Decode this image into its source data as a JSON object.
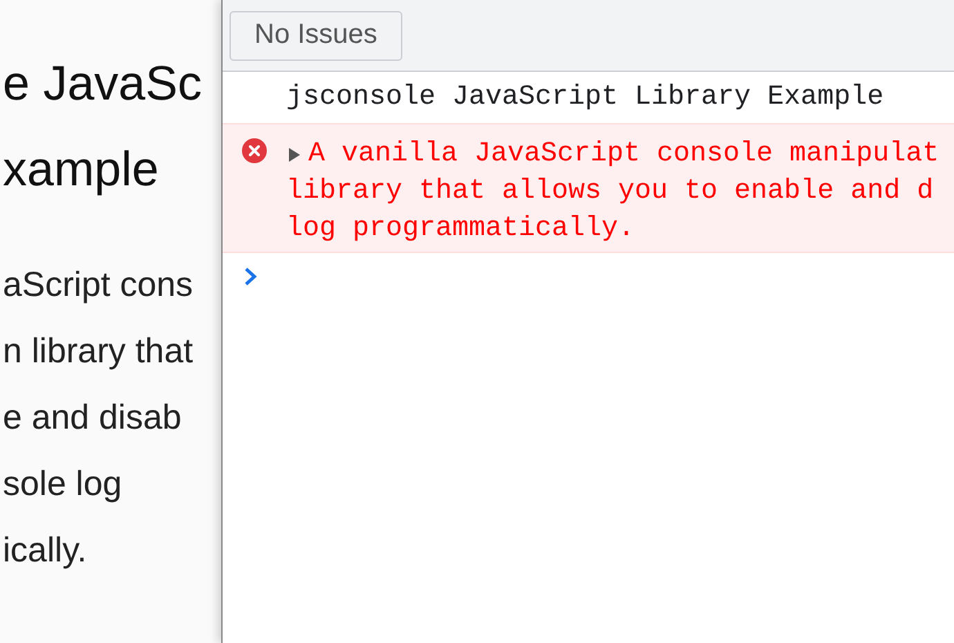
{
  "page": {
    "heading_lines": [
      "e JavaSc",
      "xample"
    ],
    "body_lines": [
      "aScript cons",
      "n library that",
      "e and disab",
      "sole log",
      "ically."
    ]
  },
  "devtools": {
    "issues_button": "No Issues",
    "messages": [
      {
        "kind": "log",
        "lines": [
          "jsconsole JavaScript Library Example"
        ]
      },
      {
        "kind": "error",
        "expanded": false,
        "lines": [
          "A vanilla JavaScript console manipulat",
          "library that allows you to enable and d",
          "log programmatically."
        ]
      }
    ]
  }
}
